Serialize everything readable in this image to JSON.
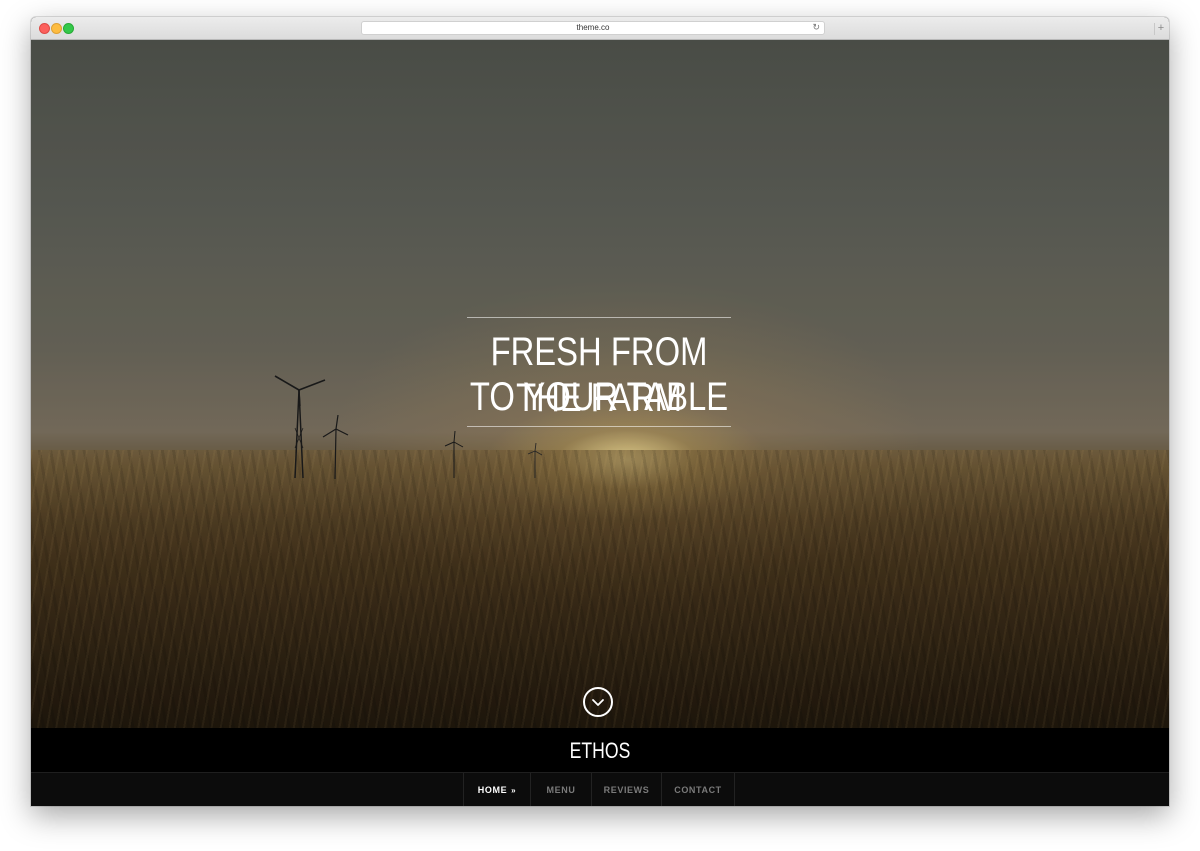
{
  "browser": {
    "url": "theme.co",
    "reload_icon": "reload-icon",
    "newtab_icon": "plus-icon"
  },
  "hero": {
    "title_line1": "FRESH FROM THE FARM",
    "title_line2": "TO YOUR TABLE",
    "scroll_icon": "chevron-down-circle-icon"
  },
  "site": {
    "brand": "ETHOS"
  },
  "nav": {
    "items": [
      {
        "label": "HOME",
        "active": true
      },
      {
        "label": "MENU",
        "active": false
      },
      {
        "label": "REVIEWS",
        "active": false
      },
      {
        "label": "CONTACT",
        "active": false
      }
    ],
    "active_marker": "»"
  },
  "colors": {
    "nav_active": "#ffffff",
    "nav_inactive": "#7a7a7a",
    "brandbar_bg": "#000000"
  }
}
